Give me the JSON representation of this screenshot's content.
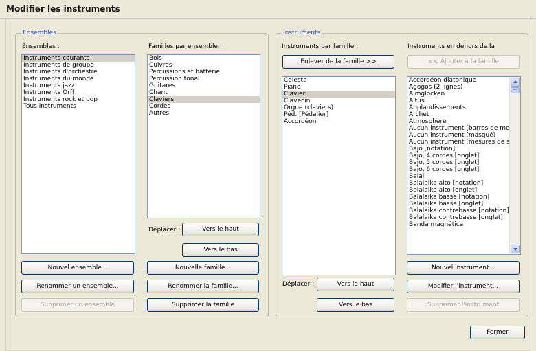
{
  "window": {
    "title": "Modifier les instruments"
  },
  "ensembles_group": {
    "legend": "Ensembles",
    "ensembles_label": "Ensembles :",
    "ensembles": [
      "Instruments courants",
      "Instruments de groupe",
      "Instruments d'orchestre",
      "Instruments du monde",
      "Instruments jazz",
      "Instruments Orff",
      "Instruments rock et pop",
      "Tous instruments"
    ],
    "selected_ensemble": "Instruments courants",
    "families_label": "Familles par ensemble :",
    "families": [
      "Bois",
      "Cuivres",
      "Percussions et batterie",
      "Percussion tonal",
      "Guitares",
      "Chant",
      "Claviers",
      "Cordes",
      "Autres"
    ],
    "selected_family": "Claviers",
    "move_label": "Déplacer :",
    "move_up": "Vers le haut",
    "move_down": "Vers le bas",
    "new_ensemble": "Nouvel ensemble...",
    "rename_ensemble": "Renommer un ensemble...",
    "delete_ensemble": "Supprimer un ensemble",
    "new_family": "Nouvelle famille...",
    "rename_family": "Renommer la famille...",
    "delete_family": "Supprimer la famille"
  },
  "instruments_group": {
    "legend": "Instruments",
    "by_family_label": "Instruments par famille :",
    "outside_label": "Instruments en dehors de la",
    "remove_from_family": "Enlever de la famille >>",
    "add_to_family": "<< Ajouter à la famille",
    "family_instruments": [
      "Celesta",
      "Piano",
      "Clavier",
      "Clavecin",
      "Orgue (claviers)",
      "Péd. [Pédalier]",
      "Accordéon"
    ],
    "selected_instrument": "Clavier",
    "outside_instruments": [
      "Accordéon diatonique",
      "Agogos (2 lignes)",
      "Almglocken",
      "Altus",
      "Applaudissements",
      "Archet",
      "Atmosphère",
      "Aucun instrument (barres de mesu",
      "Aucun instrument (masqué)",
      "Aucun instrument (mesures de sile",
      "Bajo [notation]",
      "Bajo, 4 cordes [onglet]",
      "Bajo, 5 cordes [onglet]",
      "Bajo, 6 cordes [onglet]",
      "Balai",
      "Balalaika alto [notation]",
      "Balalaika alto [onglet]",
      "Balalaika basse [notation]",
      "Balalaika basse [onglet]",
      "Balalaika contrebasse [notation]",
      "Balalaika contrebasse [onglet]",
      "Banda magnética"
    ],
    "move_label": "Déplacer :",
    "move_up": "Vers le haut",
    "move_down": "Vers le bas",
    "new_instrument": "Nouvel instrument...",
    "edit_instrument": "Modifier l'instrument...",
    "delete_instrument": "Supprimer l'instrument"
  },
  "close_button": "Fermer",
  "icons": {
    "scroll_up": "scroll-up-arrow-icon",
    "scroll_down": "scroll-down-arrow-icon"
  },
  "colors": {
    "legend": "#2a55c8",
    "selection": "#d4d0c8",
    "button_border": "#003c74"
  }
}
